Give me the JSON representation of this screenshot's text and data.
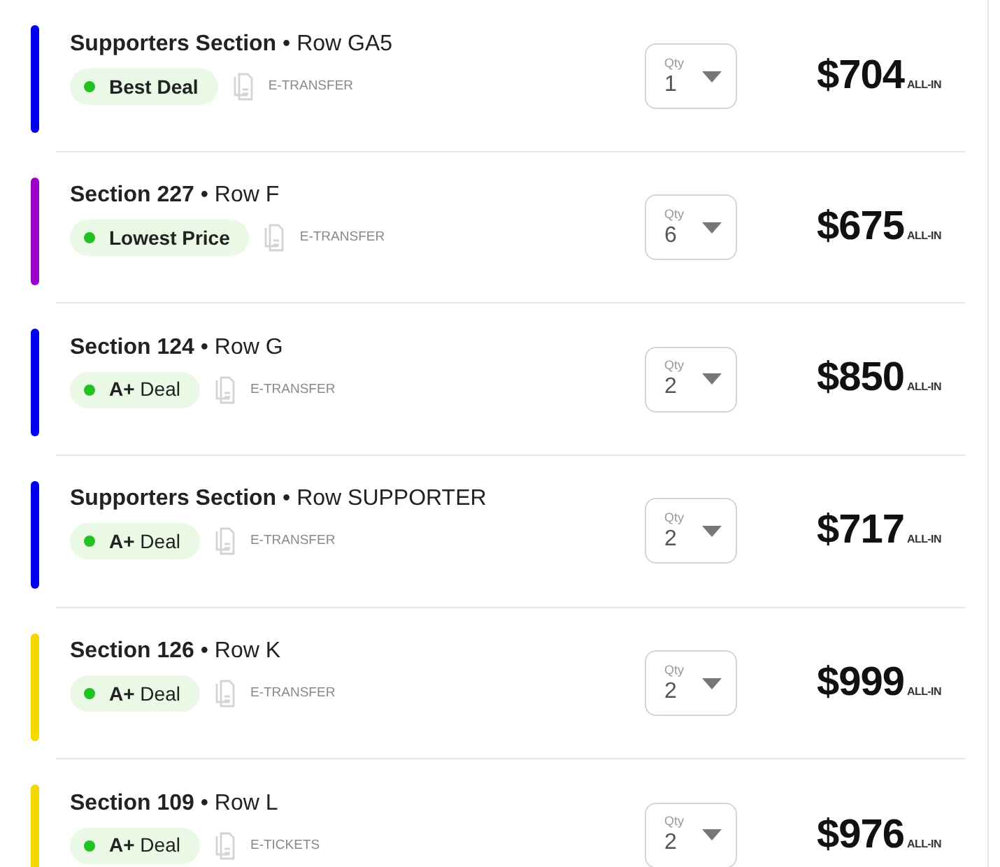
{
  "listings": [
    {
      "title": "**Supporters Section** • Row GA5",
      "color": "#0000f0",
      "badge": "**Best Deal**",
      "delivery": "E-TRANSFER",
      "qty_label": "Qty",
      "qty": "1",
      "price": "$704",
      "price_note": "ALL-IN"
    },
    {
      "title": "**Section 227** • Row F",
      "color": "#9a00c8",
      "badge": "**Lowest Price**",
      "delivery": "E-TRANSFER",
      "qty_label": "Qty",
      "qty": "6",
      "price": "$675",
      "price_note": "ALL-IN"
    },
    {
      "title": "**Section 124** • Row G",
      "color": "#0000f0",
      "badge": "**A+** Deal",
      "delivery": "E-TRANSFER",
      "qty_label": "Qty",
      "qty": "2",
      "price": "$850",
      "price_note": "ALL-IN"
    },
    {
      "title": "**Supporters Section** • Row SUPPORTER",
      "color": "#0000f0",
      "badge": "**A+** Deal",
      "delivery": "E-TRANSFER",
      "qty_label": "Qty",
      "qty": "2",
      "price": "$717",
      "price_note": "ALL-IN"
    },
    {
      "title": "**Section 126** • Row K",
      "color": "#f5d800",
      "badge": "**A+** Deal",
      "delivery": "E-TRANSFER",
      "qty_label": "Qty",
      "qty": "2",
      "price": "$999",
      "price_note": "ALL-IN"
    },
    {
      "title": "**Section 109** • Row L",
      "color": "#f5d800",
      "badge": "**A+** Deal",
      "delivery": "E-TICKETS",
      "qty_label": "Qty",
      "qty": "2",
      "price": "$976",
      "price_note": "ALL-IN"
    }
  ]
}
